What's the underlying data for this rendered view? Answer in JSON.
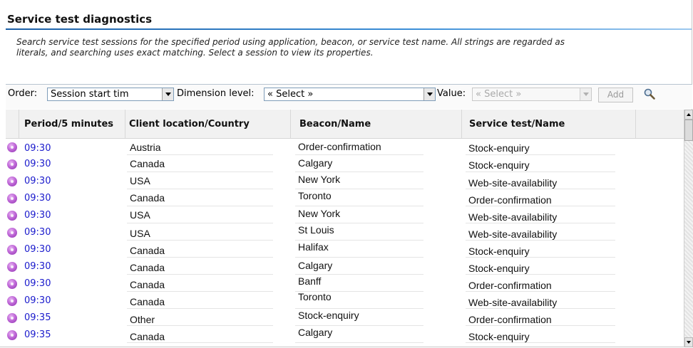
{
  "header": {
    "title": "Service test diagnostics",
    "description_lines": [
      "Search service test sessions for the specified period using application, beacon, or service test name. All strings are regarded as",
      "literals, and searching uses exact matching. Select a session to view its properties."
    ]
  },
  "filters": {
    "order_label": "Order:",
    "order_value": "Session start tim",
    "dimension_label": "Dimension level:",
    "dimension_value": "« Select »",
    "value_label": "Value:",
    "value_value": "« Select »",
    "add_label": "Add",
    "search_icon": "magnifier-icon"
  },
  "table": {
    "columns": [
      "Period/5 minutes",
      "Client location/Country",
      "Beacon/Name",
      "Service test/Name"
    ],
    "rows": [
      {
        "period": "09:30",
        "country": "Austria",
        "beacon": "Order-confirmation",
        "service": "Stock-enquiry"
      },
      {
        "period": "09:30",
        "country": "Canada",
        "beacon": "Calgary",
        "service": "Stock-enquiry"
      },
      {
        "period": "09:30",
        "country": "USA",
        "beacon": "New York",
        "service": "Web-site-availability"
      },
      {
        "period": "09:30",
        "country": "Canada",
        "beacon": "Toronto",
        "service": "Order-confirmation"
      },
      {
        "period": "09:30",
        "country": "USA",
        "beacon": "New York",
        "service": "Web-site-availability"
      },
      {
        "period": "09:30",
        "country": "USA",
        "beacon": "St Louis",
        "service": "Web-site-availability"
      },
      {
        "period": "09:30",
        "country": "Canada",
        "beacon": "Halifax",
        "service": "Stock-enquiry"
      },
      {
        "period": "09:30",
        "country": "Canada",
        "beacon": "Calgary",
        "service": "Stock-enquiry"
      },
      {
        "period": "09:30",
        "country": "Canada",
        "beacon": "Banff",
        "service": "Order-confirmation"
      },
      {
        "period": "09:30",
        "country": "Canada",
        "beacon": "Toronto",
        "service": "Web-site-availability"
      },
      {
        "period": "09:35",
        "country": "Other",
        "beacon": "Stock-enquiry",
        "service": "Order-confirmation"
      },
      {
        "period": "09:35",
        "country": "Canada",
        "beacon": "Calgary",
        "service": "Stock-enquiry"
      }
    ]
  },
  "colors": {
    "accent": "#1b5fa6",
    "link": "#1a1acc",
    "session_icon": "#b55ad0"
  }
}
